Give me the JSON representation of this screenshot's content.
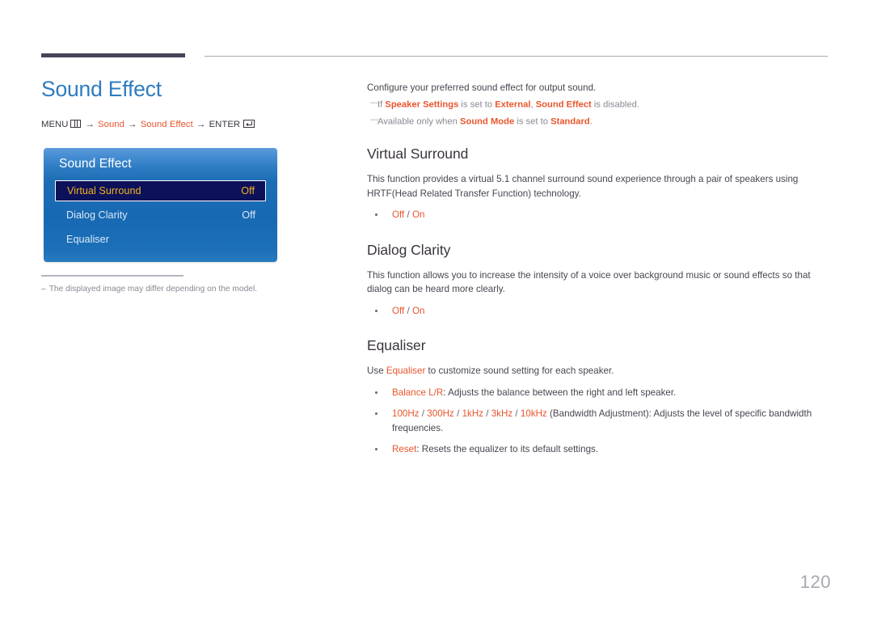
{
  "page": {
    "title": "Sound Effect",
    "number": "120"
  },
  "menu_path": {
    "prefix": "MENU",
    "menu_icon": "menu-grid-icon",
    "arrow": "→",
    "step1": "Sound",
    "step2": "Sound Effect",
    "enter": "ENTER",
    "enter_icon": "enter-key-icon"
  },
  "osd": {
    "title": "Sound Effect",
    "rows": [
      {
        "label": "Virtual Surround",
        "value": "Off",
        "selected": true
      },
      {
        "label": "Dialog Clarity",
        "value": "Off",
        "selected": false
      },
      {
        "label": "Equaliser",
        "value": "",
        "selected": false
      }
    ]
  },
  "left_footnote": {
    "dash": "–",
    "text": "The displayed image may differ depending on the model."
  },
  "intro": {
    "line": "Configure your preferred sound effect for output sound.",
    "notes": [
      {
        "dash": "―",
        "parts": [
          {
            "t": "If ",
            "accent": false
          },
          {
            "t": "Speaker Settings",
            "accent": true
          },
          {
            "t": " is set to ",
            "accent": false
          },
          {
            "t": "External",
            "accent": true
          },
          {
            "t": ", ",
            "accent": false
          },
          {
            "t": "Sound Effect",
            "accent": true
          },
          {
            "t": " is disabled.",
            "accent": false
          }
        ]
      },
      {
        "dash": "―",
        "parts": [
          {
            "t": "Available only when ",
            "accent": false
          },
          {
            "t": "Sound Mode",
            "accent": true
          },
          {
            "t": " is set to ",
            "accent": false
          },
          {
            "t": "Standard",
            "accent": true
          },
          {
            "t": ".",
            "accent": false
          }
        ]
      }
    ]
  },
  "sections": [
    {
      "heading": "Virtual Surround",
      "body": [
        {
          "t": "This function provides a virtual 5.1 channel surround sound experience through a pair of speakers using HRTF(Head Related Transfer Function) technology.",
          "accent": false
        }
      ],
      "bullets": [
        {
          "parts": [
            {
              "t": "Off",
              "accent": true
            },
            {
              "t": " / ",
              "accent": false,
              "sep": true
            },
            {
              "t": "On",
              "accent": true
            }
          ]
        }
      ]
    },
    {
      "heading": "Dialog Clarity",
      "body": [
        {
          "t": "This function allows you to increase the intensity of a voice over background music or sound effects so that dialog can be heard more clearly.",
          "accent": false
        }
      ],
      "bullets": [
        {
          "parts": [
            {
              "t": "Off",
              "accent": true
            },
            {
              "t": " / ",
              "accent": false,
              "sep": true
            },
            {
              "t": "On",
              "accent": true
            }
          ]
        }
      ]
    },
    {
      "heading": "Equaliser",
      "body": [
        {
          "t": "Use ",
          "accent": false
        },
        {
          "t": "Equaliser",
          "accent": true
        },
        {
          "t": " to customize sound setting for each speaker.",
          "accent": false
        }
      ],
      "bullets": [
        {
          "parts": [
            {
              "t": "Balance L/R",
              "accent": true
            },
            {
              "t": ": Adjusts the balance between the right and left speaker.",
              "accent": false
            }
          ]
        },
        {
          "parts": [
            {
              "t": "100Hz",
              "accent": true
            },
            {
              "t": " / ",
              "accent": false,
              "sep": true
            },
            {
              "t": "300Hz",
              "accent": true
            },
            {
              "t": " / ",
              "accent": false,
              "sep": true
            },
            {
              "t": "1kHz",
              "accent": true
            },
            {
              "t": " / ",
              "accent": false,
              "sep": true
            },
            {
              "t": "3kHz",
              "accent": true
            },
            {
              "t": " / ",
              "accent": false,
              "sep": true
            },
            {
              "t": "10kHz",
              "accent": true
            },
            {
              "t": " (Bandwidth Adjustment): Adjusts the level of specific bandwidth frequencies.",
              "accent": false
            }
          ]
        },
        {
          "parts": [
            {
              "t": "Reset",
              "accent": true
            },
            {
              "t": ": Resets the equalizer to its default settings.",
              "accent": false
            }
          ]
        }
      ]
    }
  ],
  "colors": {
    "accent": "#e8552d",
    "title_blue": "#2e7cc0",
    "heading": "#3b3440",
    "rule_dark": "#474458",
    "osd_highlight": "#0d1159",
    "osd_highlight_text": "#f0b323",
    "page_number": "#a9a6b0"
  }
}
